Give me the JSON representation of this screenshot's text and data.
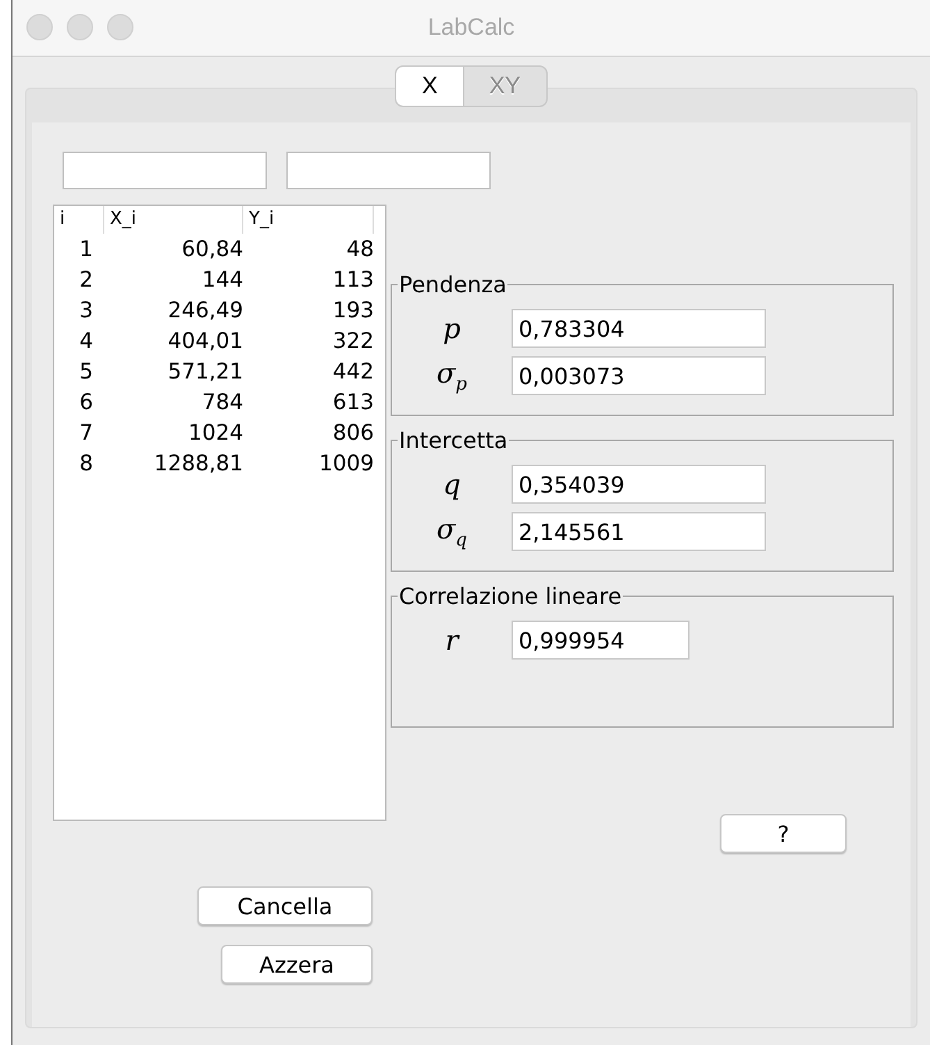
{
  "window": {
    "title": "LabCalc"
  },
  "tabs": [
    {
      "label": "X",
      "selected": true
    },
    {
      "label": "XY",
      "selected": false
    }
  ],
  "inputs": [
    {
      "kind": "text"
    },
    {
      "kind": "text"
    }
  ],
  "table": {
    "columns": [
      "i",
      "X_i",
      "Y_i"
    ],
    "rows": [
      [
        "1",
        "60,84",
        "48"
      ],
      [
        "2",
        "144",
        "113"
      ],
      [
        "3",
        "246,49",
        "193"
      ],
      [
        "4",
        "404,01",
        "322"
      ],
      [
        "5",
        "571,21",
        "442"
      ],
      [
        "6",
        "784",
        "613"
      ],
      [
        "7",
        "1024",
        "806"
      ],
      [
        "8",
        "1288,81",
        "1009"
      ]
    ]
  },
  "groups": [
    {
      "title": "Pendenza",
      "fields": [
        {
          "symbol": "p",
          "value": "0,783304"
        },
        {
          "symbol": "σ",
          "subscript": "p",
          "value": "0,003073"
        }
      ]
    },
    {
      "title": "Intercetta",
      "fields": [
        {
          "symbol": "q",
          "value": "0,354039"
        },
        {
          "symbol": "σ",
          "subscript": "q",
          "value": "2,145561"
        }
      ]
    },
    {
      "title": "Correlazione lineare",
      "fields": [
        {
          "symbol": "r",
          "value": "0,999954"
        }
      ]
    }
  ],
  "buttons": {
    "help": "?",
    "clear": "Cancella",
    "reset": "Azzera"
  }
}
